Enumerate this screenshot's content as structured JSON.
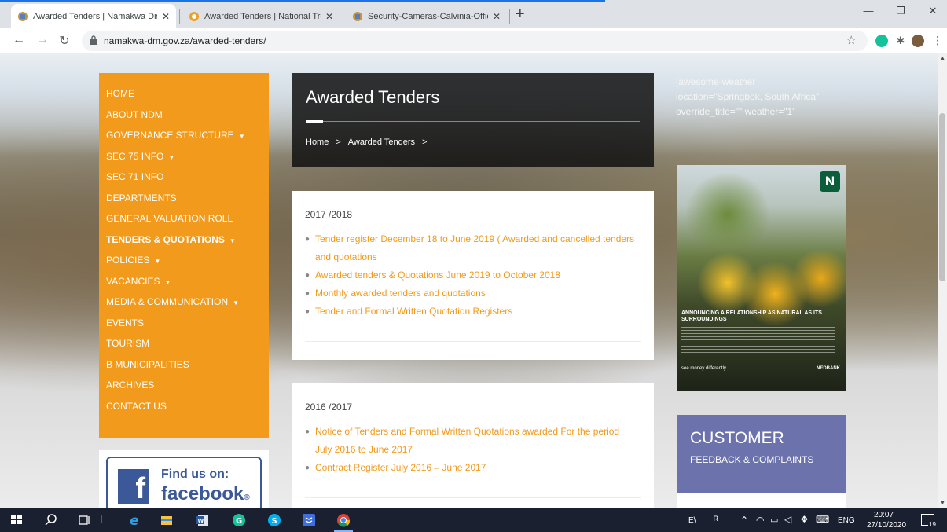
{
  "browser": {
    "tabs": [
      {
        "title": "Awarded Tenders | Namakwa Dis",
        "active": true
      },
      {
        "title": "Awarded Tenders | National Treas",
        "active": false
      },
      {
        "title": "Security-Cameras-Calvinia-Office",
        "active": false
      }
    ],
    "url": "namakwa-dm.gov.za/awarded-tenders/"
  },
  "nav": {
    "items": [
      {
        "label": "HOME",
        "bold": false,
        "caret": false
      },
      {
        "label": "ABOUT NDM",
        "bold": false,
        "caret": false
      },
      {
        "label": "GOVERNANCE STRUCTURE",
        "bold": false,
        "caret": true
      },
      {
        "label": "SEC 75 INFO",
        "bold": false,
        "caret": true
      },
      {
        "label": "SEC 71 INFO",
        "bold": false,
        "caret": false
      },
      {
        "label": "DEPARTMENTS",
        "bold": false,
        "caret": false
      },
      {
        "label": "GENERAL VALUATION ROLL",
        "bold": false,
        "caret": false
      },
      {
        "label": "TENDERS & QUOTATIONS",
        "bold": true,
        "caret": true
      },
      {
        "label": "POLICIES",
        "bold": false,
        "caret": true
      },
      {
        "label": "VACANCIES",
        "bold": false,
        "caret": true
      },
      {
        "label": "MEDIA & COMMUNICATION",
        "bold": false,
        "caret": true
      },
      {
        "label": "EVENTS",
        "bold": false,
        "caret": false
      },
      {
        "label": "TOURISM",
        "bold": false,
        "caret": false
      },
      {
        "label": "B MUNICIPALITIES",
        "bold": false,
        "caret": false
      },
      {
        "label": "ARCHIVES",
        "bold": false,
        "caret": false
      },
      {
        "label": "CONTACT US",
        "bold": false,
        "caret": false
      }
    ],
    "caret_glyph": "▼"
  },
  "facebook": {
    "line1": "Find us on:",
    "line2": "facebook",
    "mark": "®",
    "f": "f"
  },
  "header": {
    "title": "Awarded Tenders",
    "crumb_home": "Home",
    "crumb_sep": ">",
    "crumb_current": "Awarded Tenders"
  },
  "sections": [
    {
      "year": "2017 /2018",
      "links": [
        "Tender register December 18 to June 2019 ( Awarded and cancelled tenders and quotations",
        "Awarded tenders & Quotations June 2019 to October 2018",
        "Monthly awarded tenders and quotations",
        "Tender and Formal Written Quotation Registers"
      ]
    },
    {
      "year": "2016 /2017",
      "links": [
        "Notice of Tenders and Formal Written Quotations awarded For the period July 2016 to June 2017",
        "Contract Register July 2016 – June 2017"
      ]
    }
  ],
  "weather": {
    "lines": [
      "[awesome-weather",
      "location=\"Springbok, South Africa\"",
      "override_title=\"\" weather=\"1\""
    ]
  },
  "ad": {
    "headline": "ANNOUNCING A RELATIONSHIP AS NATURAL AS ITS SURROUNDINGS",
    "tagline": "see money differently",
    "brand": "NEDBANK"
  },
  "customer": {
    "title": "CUSTOMER",
    "subtitle": "FEEDBACK & COMPLAINTS"
  },
  "taskbar": {
    "lang": "ENG",
    "time": "20:07",
    "date": "27/10/2020",
    "notif_count": "19",
    "e_label": "E\\"
  }
}
